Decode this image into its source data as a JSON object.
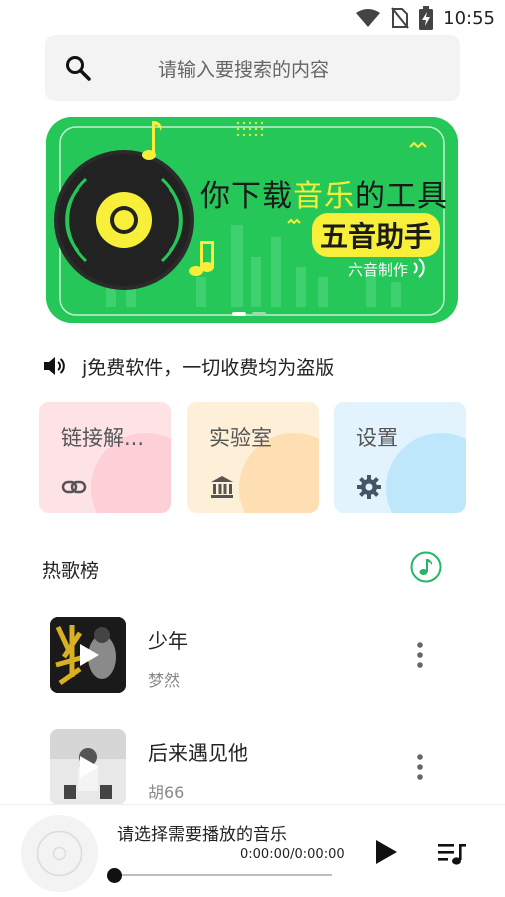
{
  "status_bar": {
    "time": "10:55",
    "icons": [
      "wifi-icon",
      "no-sim-icon",
      "battery-charging-icon"
    ]
  },
  "search": {
    "placeholder": "请输入要搜索的内容",
    "icon": "search-icon"
  },
  "banner": {
    "title_pre": "你下载",
    "title_highlight": "音乐",
    "title_post": "的工具",
    "brand": "五音助手",
    "credit": "六音制作",
    "colors": {
      "background": "#26c759",
      "highlight": "#f7ef3a"
    },
    "slide_count": 2,
    "active_slide": 0
  },
  "notice": {
    "icon": "speaker-icon",
    "text": "j免费软件，一切收费均为盗版"
  },
  "quick_actions": [
    {
      "label": "链接解...",
      "icon": "link-icon",
      "color": "#fde3e6"
    },
    {
      "label": "实验室",
      "icon": "bank-icon",
      "color": "#fdefd8"
    },
    {
      "label": "设置",
      "icon": "gear-icon",
      "color": "#e2f3fd"
    }
  ],
  "hot_songs": {
    "title": "热歌榜",
    "icon": "music-note-icon",
    "accent": "#26b46a",
    "items": [
      {
        "title": "少年",
        "artist": "梦然"
      },
      {
        "title": "后来遇见他",
        "artist": "胡66"
      }
    ]
  },
  "player": {
    "title": "请选择需要播放的音乐",
    "time": "0:00:00/0:00:00",
    "progress": 0,
    "play_icon": "play-icon",
    "queue_icon": "playlist-icon"
  }
}
